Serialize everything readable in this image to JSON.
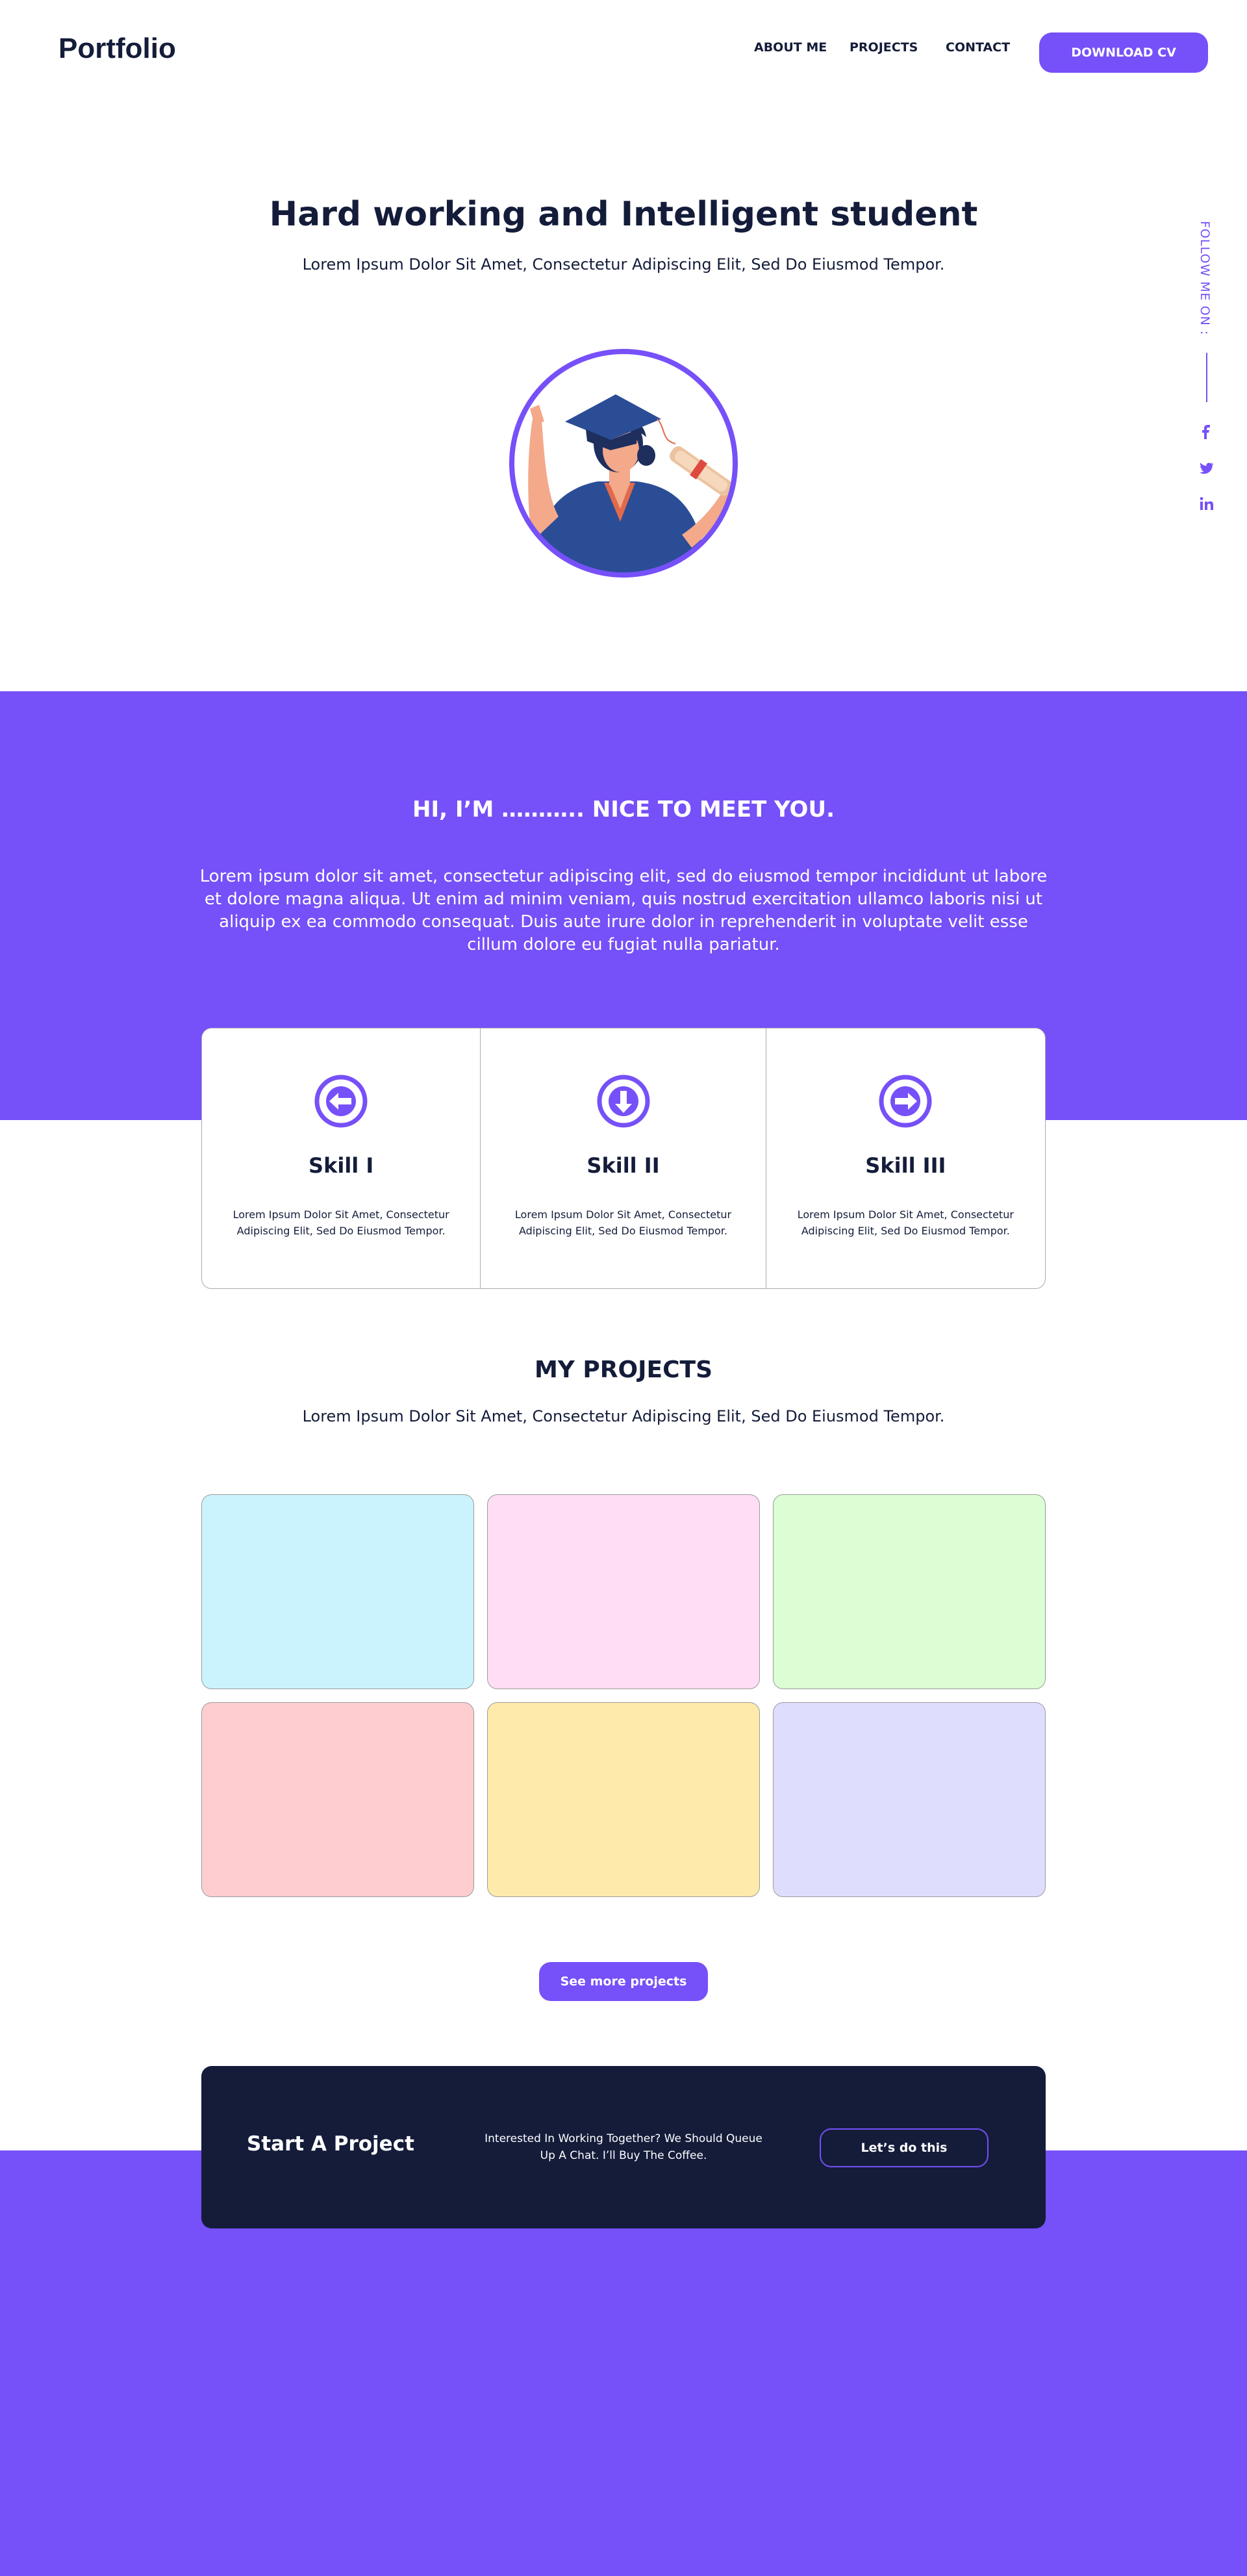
{
  "header": {
    "logo": "Portfolio",
    "nav": [
      "ABOUT ME",
      "PROJECTS",
      "CONTACT"
    ],
    "download_label": "DOWNLOAD CV"
  },
  "hero": {
    "title": "Hard working and Intelligent student",
    "subtitle": "Lorem Ipsum Dolor Sit Amet, Consectetur Adipiscing Elit, Sed Do Eiusmod Tempor."
  },
  "social": {
    "follow_label": "FOLLOW ME ON :",
    "icons": [
      "facebook-icon",
      "twitter-icon",
      "linkedin-icon"
    ]
  },
  "intro": {
    "title": "HI, I’M ……….. NICE TO MEET YOU.",
    "text": "Lorem ipsum dolor sit amet, consectetur adipiscing elit, sed do eiusmod tempor incididunt ut labore et dolore magna aliqua. Ut enim ad minim veniam, quis nostrud exercitation ullamco laboris nisi ut aliquip ex ea commodo consequat. Duis aute irure dolor in reprehenderit in voluptate velit esse cillum dolore eu fugiat nulla pariatur."
  },
  "skills": [
    {
      "name": "Skill I",
      "icon": "arrow-left-circle-icon",
      "desc": "Lorem Ipsum Dolor Sit Amet, Consectetur Adipiscing Elit, Sed Do Eiusmod Tempor."
    },
    {
      "name": "Skill II",
      "icon": "arrow-down-circle-icon",
      "desc": "Lorem Ipsum Dolor Sit Amet, Consectetur Adipiscing Elit, Sed Do Eiusmod Tempor."
    },
    {
      "name": "Skill III",
      "icon": "arrow-right-circle-icon",
      "desc": "Lorem Ipsum Dolor Sit Amet, Consectetur Adipiscing Elit, Sed Do Eiusmod Tempor."
    }
  ],
  "projects": {
    "title": "MY PROJECTS",
    "subtitle": "Lorem Ipsum Dolor Sit Amet, Consectetur Adipiscing Elit, Sed Do Eiusmod Tempor.",
    "card_colors": [
      "#caf3fd",
      "#feddf5",
      "#dcfed4",
      "#fecdd0",
      "#feeaab",
      "#deddfe"
    ],
    "more_label": "See more projects"
  },
  "cta": {
    "title": "Start A Project",
    "text": "Interested In Working Together? We Should Queue Up A Chat. I’ll Buy The Coffee.",
    "button": "Let’s do this"
  },
  "colors": {
    "accent": "#7650f8",
    "dark": "#141c3a"
  }
}
